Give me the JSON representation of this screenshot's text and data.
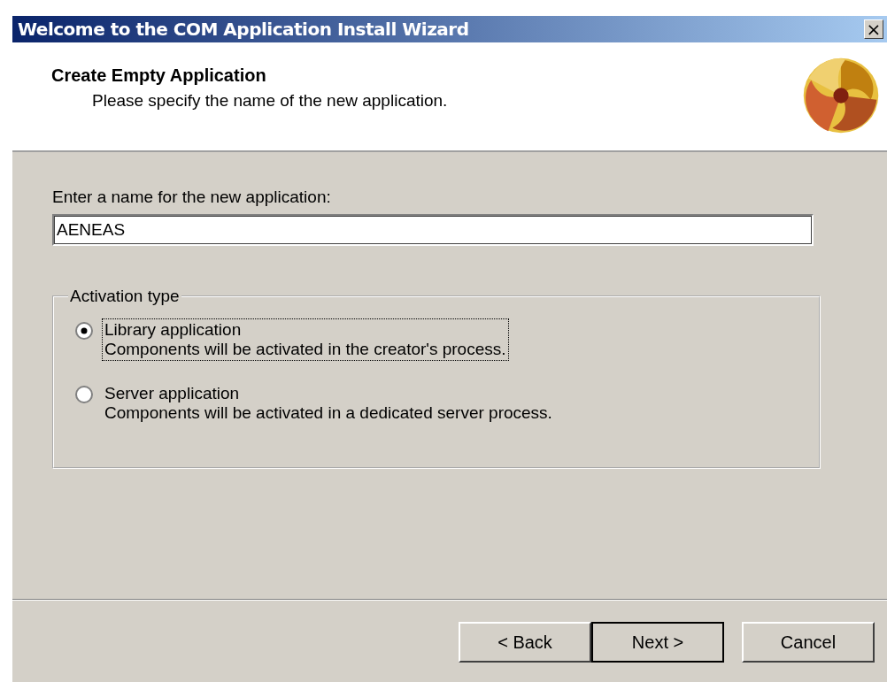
{
  "window": {
    "title": "Welcome to the COM Application Install Wizard",
    "close": "×"
  },
  "header": {
    "title": "Create Empty Application",
    "subtitle": "Please specify the name of the new application."
  },
  "name_field": {
    "label": "Enter a name for the new application:",
    "value": "AENEAS"
  },
  "activation": {
    "legend": "Activation type",
    "options": [
      {
        "label": "Library application",
        "description": "Components will be activated in the creator's process.",
        "selected": true,
        "focused": true
      },
      {
        "label": "Server application",
        "description": "Components will be activated in a dedicated server process.",
        "selected": false,
        "focused": false
      }
    ]
  },
  "buttons": [
    {
      "label": "< Back",
      "default": false
    },
    {
      "label": "Next >",
      "default": true
    },
    {
      "label": "Cancel",
      "default": false
    }
  ]
}
